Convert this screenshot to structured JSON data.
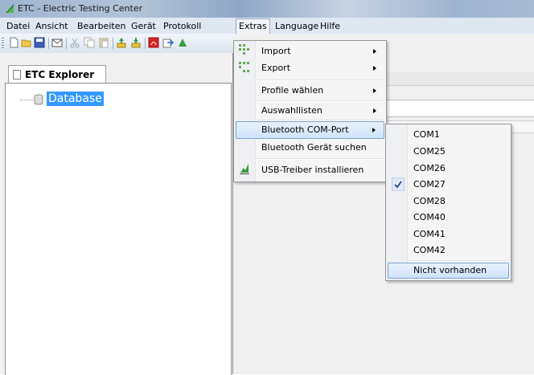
{
  "window": {
    "title": "ETC - Electric Testing Center"
  },
  "menubar": {
    "items": [
      {
        "label": "Datei"
      },
      {
        "label": "Ansicht"
      },
      {
        "label": "Bearbeiten"
      },
      {
        "label": "Gerät"
      },
      {
        "label": "Protokoll"
      },
      {
        "label": "Extras"
      },
      {
        "label": "Language"
      },
      {
        "label": "Hilfe"
      }
    ],
    "active": "Extras"
  },
  "toolbar": {
    "icons": [
      "new-icon",
      "open-folder-icon",
      "save-icon",
      "email-icon",
      "cut-icon",
      "copy-icon",
      "paste-icon",
      "upload-icon",
      "download-icon",
      "pdf-icon",
      "export-icon"
    ]
  },
  "explorer": {
    "tab_label": "ETC Explorer",
    "tree": [
      {
        "label": "Database",
        "selected": true
      }
    ]
  },
  "extras_menu": {
    "items": [
      {
        "label": "Import",
        "submenu": true
      },
      {
        "label": "Export",
        "submenu": true
      },
      {
        "label": "Profile wählen",
        "submenu": true
      },
      {
        "label": "Auswahllisten",
        "submenu": true
      },
      {
        "label": "Bluetooth COM-Port",
        "submenu": true,
        "highlighted": true
      },
      {
        "label": "Bluetooth Gerät suchen",
        "submenu": false
      },
      {
        "label": "USB-Treiber installieren",
        "submenu": false
      }
    ]
  },
  "com_port_menu": {
    "items": [
      {
        "label": "COM1",
        "checked": false
      },
      {
        "label": "COM25",
        "checked": false
      },
      {
        "label": "COM26",
        "checked": false
      },
      {
        "label": "COM27",
        "checked": true
      },
      {
        "label": "COM28",
        "checked": false
      },
      {
        "label": "COM40",
        "checked": false
      },
      {
        "label": "COM41",
        "checked": false
      },
      {
        "label": "COM42",
        "checked": false
      },
      {
        "label": "Nicht vorhanden",
        "checked": false,
        "highlighted": true
      }
    ]
  },
  "colors": {
    "selection": "#3399ff",
    "menu_highlight": "#cfe3fb",
    "menu_highlight_border": "#7da2ce",
    "menubar_bg": "#dfe7f1"
  }
}
